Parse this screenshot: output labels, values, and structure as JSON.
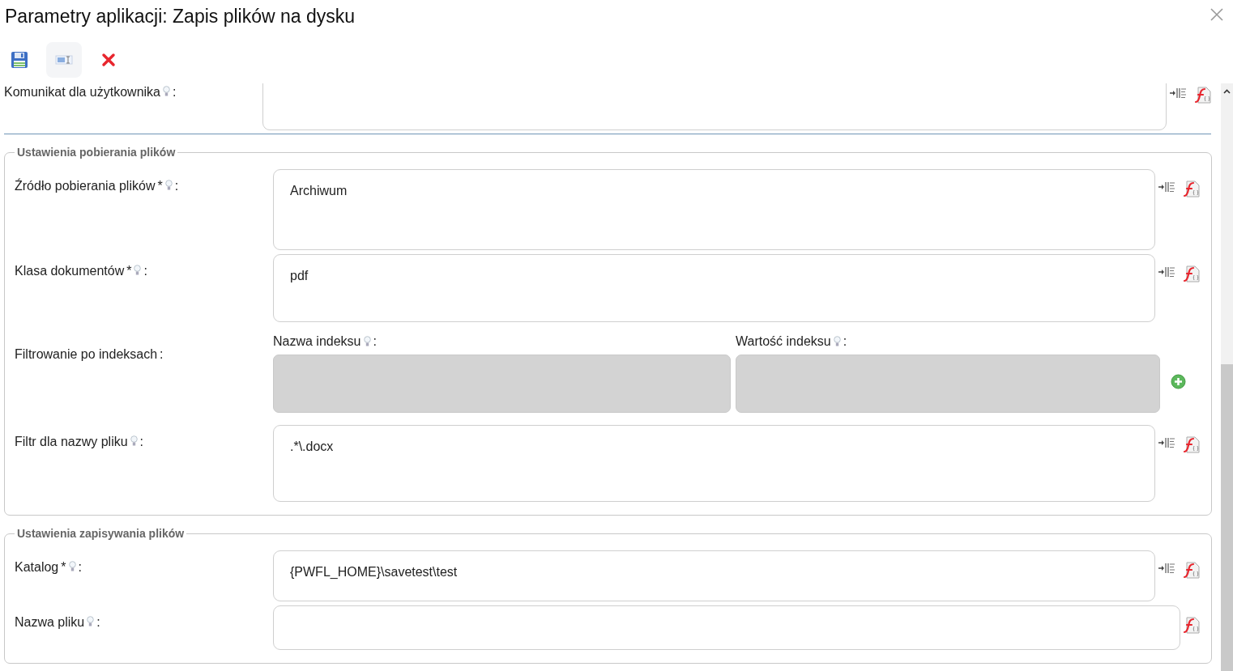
{
  "title": "Parametry aplikacji: Zapis plików na dysku",
  "toolbar": [
    {
      "kind": "save"
    },
    {
      "kind": "toggle"
    },
    {
      "kind": "delete"
    }
  ],
  "top_rows": [
    {
      "kind": "text",
      "label": "Komunikat dla użytkownika",
      "hint": true,
      "colon": ":",
      "tools": [
        {
          "kind": "insert"
        },
        {
          "kind": "fx"
        }
      ]
    }
  ],
  "groups": [
    {
      "legend": "Ustawienia pobierania plików",
      "rows": [
        {
          "kind": "text",
          "label": "Źródło pobierania plików",
          "required_mark": "*",
          "hint": true,
          "colon": ":",
          "value": "Archiwum",
          "tools": [
            {
              "kind": "insert"
            },
            {
              "kind": "fx"
            }
          ]
        },
        {
          "kind": "text",
          "label": "Klasa dokumentów",
          "required_mark": "*",
          "hint": true,
          "colon": ":",
          "value": "pdf",
          "tools": [
            {
              "kind": "insert"
            },
            {
              "kind": "fx"
            }
          ]
        },
        {
          "kind": "index_filter",
          "label": "Filtrowanie po indeksach",
          "colon": ":",
          "columns": [
            {
              "label": "Nazwa indeksu",
              "hint": true,
              "colon": ":",
              "disabled": true
            },
            {
              "label": "Wartość indeksu",
              "hint": true,
              "colon": ":",
              "disabled": true
            }
          ],
          "add_button": true
        },
        {
          "kind": "text",
          "label": "Filtr dla nazwy pliku",
          "hint": true,
          "colon": ":",
          "value": ".*\\.docx",
          "tools": [
            {
              "kind": "insert"
            },
            {
              "kind": "fx"
            }
          ]
        }
      ]
    },
    {
      "legend": "Ustawienia zapisywania plików",
      "rows": [
        {
          "kind": "text",
          "label": "Katalog",
          "required_mark": "*",
          "hint": true,
          "colon": ":",
          "value": "{PWFL_HOME}\\savetest\\test",
          "tools": [
            {
              "kind": "insert"
            },
            {
              "kind": "fx"
            }
          ]
        },
        {
          "kind": "text",
          "label": "Nazwa pliku",
          "hint": true,
          "colon": ":",
          "tools": [
            {
              "kind": "fx"
            }
          ]
        }
      ]
    }
  ]
}
